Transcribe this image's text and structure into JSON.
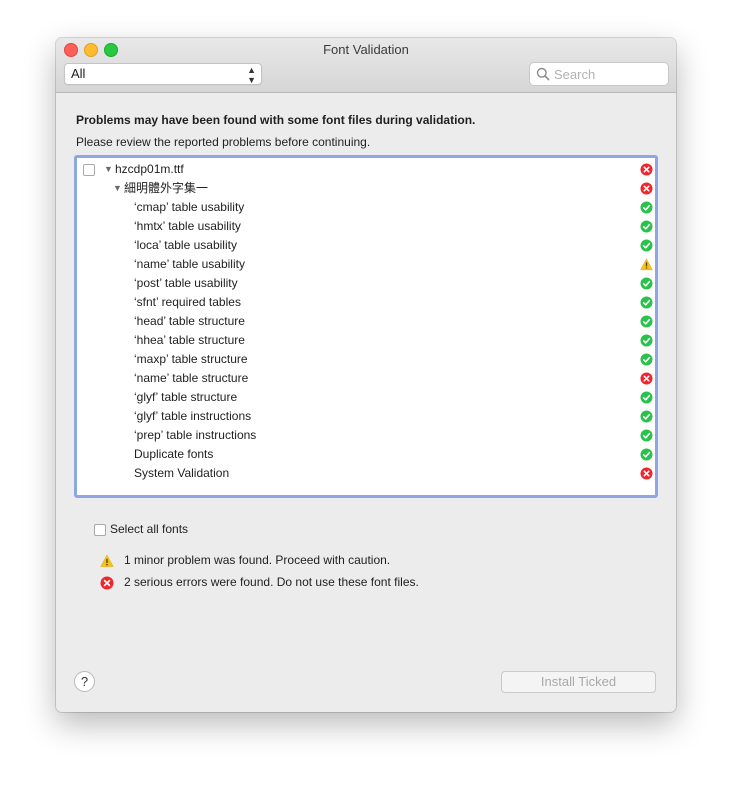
{
  "window": {
    "title": "Font Validation"
  },
  "toolbar": {
    "filter_value": "All",
    "search_placeholder": "Search"
  },
  "message": {
    "headline": "Problems may have been found with some font files during validation.",
    "subline": "Please review the reported problems before continuing."
  },
  "tree": {
    "file": {
      "label": "hzcdp01m.ttf",
      "status": "error",
      "checked": false
    },
    "font": {
      "label": "細明體外字集一",
      "status": "error"
    },
    "checks": [
      {
        "label": "‘cmap’ table usability",
        "status": "ok"
      },
      {
        "label": "‘hmtx’ table usability",
        "status": "ok"
      },
      {
        "label": "‘loca’ table usability",
        "status": "ok"
      },
      {
        "label": "‘name’ table usability",
        "status": "warning"
      },
      {
        "label": "‘post’ table usability",
        "status": "ok"
      },
      {
        "label": "‘sfnt’ required tables",
        "status": "ok"
      },
      {
        "label": "‘head’ table structure",
        "status": "ok"
      },
      {
        "label": "‘hhea’ table structure",
        "status": "ok"
      },
      {
        "label": "‘maxp’ table structure",
        "status": "ok"
      },
      {
        "label": "‘name’ table structure",
        "status": "error"
      },
      {
        "label": "‘glyf’ table structure",
        "status": "ok"
      },
      {
        "label": "‘glyf’ table instructions",
        "status": "ok"
      },
      {
        "label": "‘prep’ table instructions",
        "status": "ok"
      },
      {
        "label": "Duplicate fonts",
        "status": "ok"
      },
      {
        "label": "System Validation",
        "status": "error"
      }
    ]
  },
  "select_all_label": "Select all fonts",
  "summary": {
    "warning": "1 minor problem was found. Proceed with caution.",
    "error": "2 serious errors were found. Do not use these font files."
  },
  "buttons": {
    "help": "?",
    "install": "Install Ticked"
  },
  "colors": {
    "ok": "#29c24a",
    "error": "#f0262d",
    "warning": "#f5c21b",
    "selection_border": "#8fa6e5"
  }
}
